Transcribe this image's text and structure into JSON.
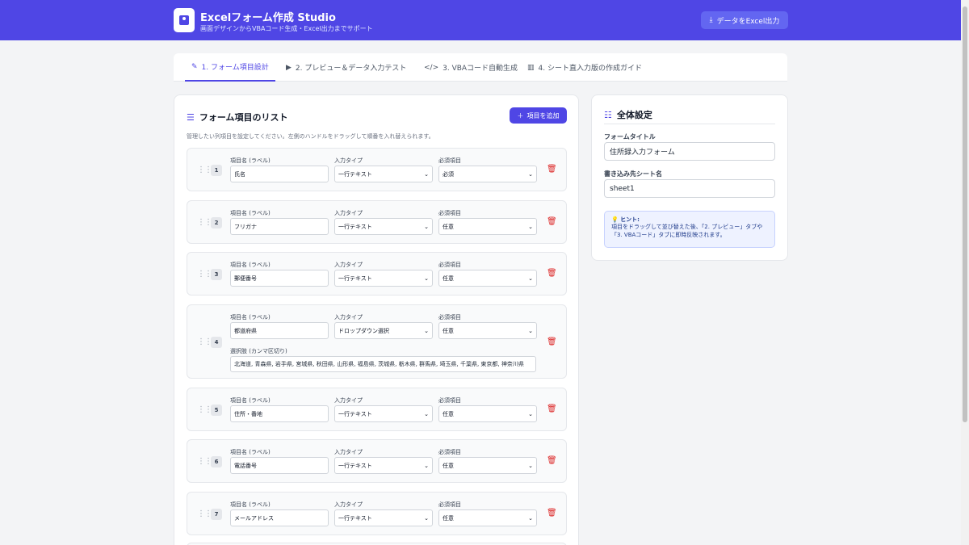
{
  "header": {
    "title": "Excelフォーム作成 Studio",
    "subtitle": "画面デザインからVBAコード生成・Excel出力までサポート",
    "export_label": "データをExcel出力"
  },
  "tabs": [
    {
      "label": "1. フォーム項目設計",
      "icon": "edit-icon"
    },
    {
      "label": "2. プレビュー＆データ入力テスト",
      "icon": "play-icon"
    },
    {
      "label": "3. VBAコード自動生成",
      "icon": "code-icon"
    },
    {
      "label": "4. シート直入力版の作成ガイド",
      "icon": "book-icon"
    }
  ],
  "list": {
    "title": "フォーム項目のリスト",
    "add_label": "項目を追加",
    "description": "管理したい列項目を設定してください。左側のハンドルをドラッグして順番を入れ替えられます。",
    "col_label": "項目名 (ラベル)",
    "col_type": "入力タイプ",
    "col_required": "必須項目",
    "options_label": "選択肢 (カンマ区切り)",
    "items": [
      {
        "num": "1",
        "label": "氏名",
        "type": "一行テキスト",
        "required": "必須"
      },
      {
        "num": "2",
        "label": "フリガナ",
        "type": "一行テキスト",
        "required": "任意"
      },
      {
        "num": "3",
        "label": "郵便番号",
        "type": "一行テキスト",
        "required": "任意"
      },
      {
        "num": "4",
        "label": "都道府県",
        "type": "ドロップダウン選択",
        "required": "任意",
        "options": "北海道, 青森県, 岩手県, 宮城県, 秋田県, 山形県, 福島県, 茨城県, 栃木県, 群馬県, 埼玉県, 千葉県, 東京都, 神奈川県"
      },
      {
        "num": "5",
        "label": "住所・番地",
        "type": "一行テキスト",
        "required": "任意"
      },
      {
        "num": "6",
        "label": "電話番号",
        "type": "一行テキスト",
        "required": "任意"
      },
      {
        "num": "7",
        "label": "メールアドレス",
        "type": "一行テキスト",
        "required": "任意"
      }
    ]
  },
  "settings": {
    "title": "全体設定",
    "form_title_label": "フォームタイトル",
    "form_title_value": "住所録入力フォーム",
    "sheet_label": "書き込み先シート名",
    "sheet_value": "sheet1",
    "hint_head": "ヒント:",
    "hint_text": "項目をドラッグして並び替えた後、「2. プレビュー」タブや「3. VBAコード」タブに即時反映されます。"
  },
  "colors": {
    "accent": "#4f46e5",
    "danger": "#dc2626"
  }
}
